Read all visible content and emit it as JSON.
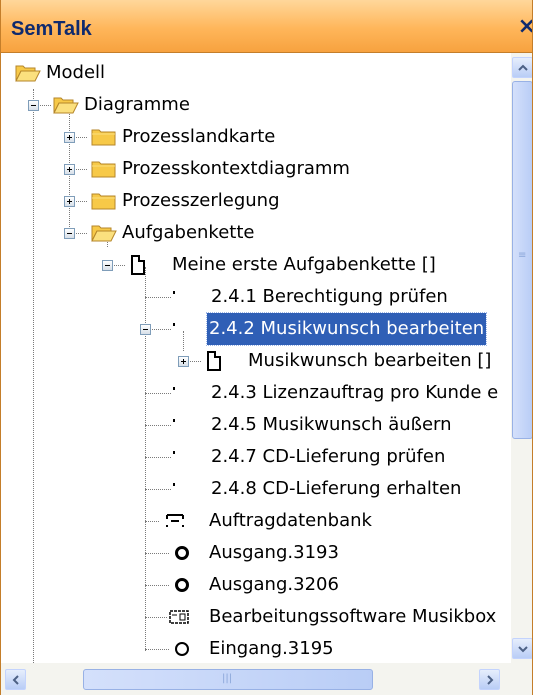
{
  "window": {
    "title": "SemTalk",
    "close_label": "×"
  },
  "tree": {
    "root": "Modell",
    "diagramme": "Diagramme",
    "prozesslandkarte": "Prozesslandkarte",
    "prozesskontextdiagramm": "Prozesskontextdiagramm",
    "prozesszerlegung": "Prozesszerlegung",
    "aufgabenkette": "Aufgabenkette",
    "meine_erste": "Meine erste Aufgabenkette []",
    "item_241": "2.4.1 Berechtigung prüfen",
    "item_242": "2.4.2 Musikwunsch bearbeiten",
    "musikwunsch_diagram": "Musikwunsch bearbeiten []",
    "item_243": "2.4.3 Lizenzauftrag pro Kunde e",
    "item_245": "2.4.5 Musikwunsch äußern",
    "item_247": "2.4.7 CD-Lieferung prüfen",
    "item_248": "2.4.8 CD-Lieferung erhalten",
    "auftragdatenbank": "Auftragdatenbank",
    "ausgang_3193": "Ausgang.3193",
    "ausgang_3206": "Ausgang.3206",
    "bearbeitungssoftware": "Bearbeitungssoftware Musikbox",
    "eingang_3195": "Eingang.3195"
  },
  "icons": {
    "folder_color": "#f7c948",
    "selection_color": "#2f5fb6",
    "titlebar_color": "#ffb65a"
  }
}
